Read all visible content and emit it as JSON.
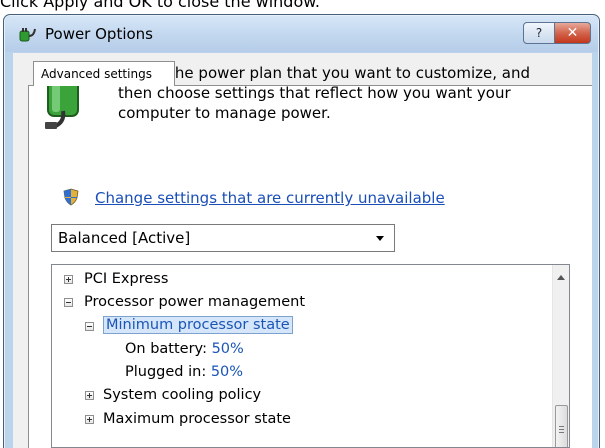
{
  "instruction": "Click Apply and OK to close the window.",
  "window": {
    "title": "Power Options",
    "help_label": "?",
    "close_label": "✕"
  },
  "tab": {
    "label": "Advanced settings"
  },
  "description": "Select the power plan that you want to customize, and then choose settings that reflect how you want your computer to manage power.",
  "change_link": "Change settings that are currently unavailable",
  "plan_dropdown": {
    "selected": "Balanced [Active]"
  },
  "tree": {
    "pci_express": "PCI Express",
    "processor_power_management": "Processor power management",
    "minimum_processor_state": "Minimum processor state",
    "on_battery_label": "On battery:",
    "on_battery_value": "50%",
    "plugged_in_label": "Plugged in:",
    "plugged_in_value": "50%",
    "system_cooling_policy": "System cooling policy",
    "maximum_processor_state": "Maximum processor state"
  },
  "colors": {
    "link": "#1a4fb8",
    "selection_text": "#1a55b6",
    "close_button": "#c2371c"
  }
}
